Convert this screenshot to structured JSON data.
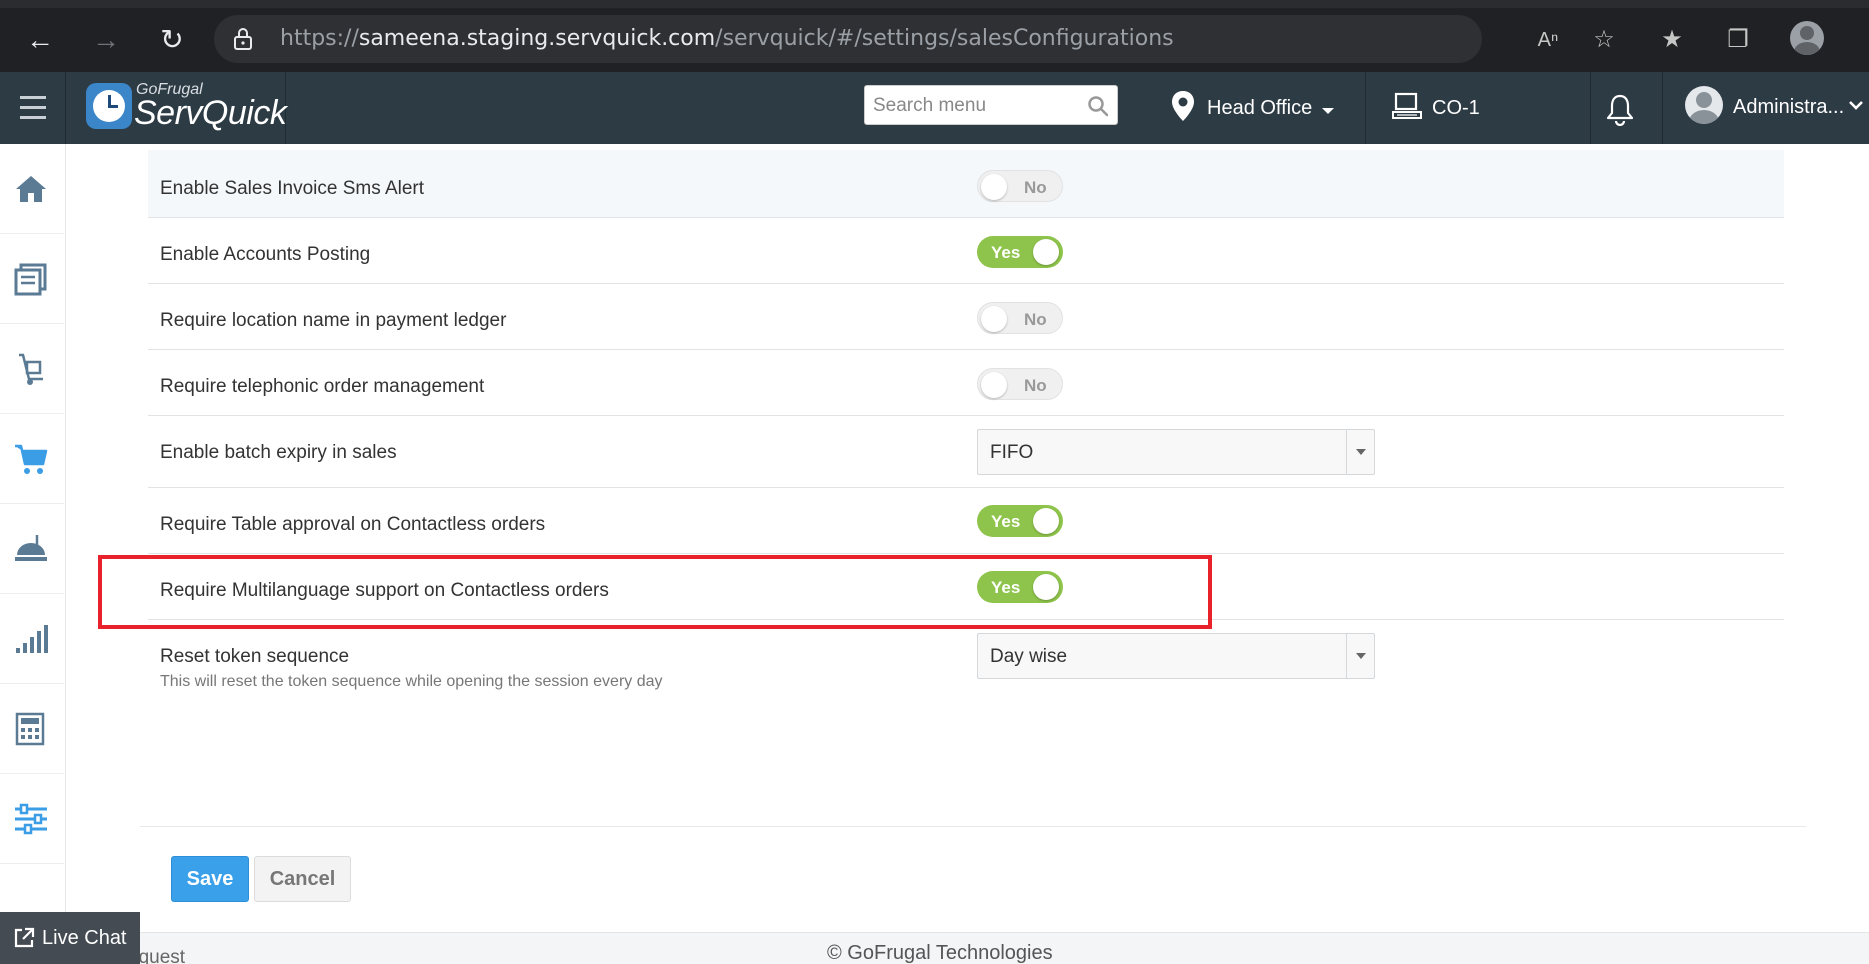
{
  "browser": {
    "url_prefix": "https://",
    "url_host": "sameena.staging.servquick.com",
    "url_path": "/servquick/#/settings/salesConfigurations"
  },
  "header": {
    "logo_small": "GoFrugal",
    "logo_big": "ServQuick",
    "search_placeholder": "Search menu",
    "location": "Head Office",
    "counter": "CO-1",
    "user": "Administra..."
  },
  "sidebar": {
    "items": [
      "home-icon",
      "books-icon",
      "trolley-icon",
      "cart-icon",
      "serve-dish-icon",
      "bar-chart-icon",
      "calculator-icon",
      "sliders-icon"
    ]
  },
  "settings": {
    "rows": [
      {
        "label": "Enable Sales Invoice Sms Alert",
        "control": "toggle",
        "value": "No"
      },
      {
        "label": "Enable Accounts Posting",
        "control": "toggle",
        "value": "Yes"
      },
      {
        "label": "Require location name in payment ledger",
        "control": "toggle",
        "value": "No"
      },
      {
        "label": "Require telephonic order management",
        "control": "toggle",
        "value": "No"
      },
      {
        "label": "Enable batch expiry in sales",
        "control": "select",
        "value": "FIFO"
      },
      {
        "label": "Require Table approval on Contactless orders",
        "control": "toggle",
        "value": "Yes"
      },
      {
        "label": "Require Multilanguage support on Contactless orders",
        "control": "toggle",
        "value": "Yes"
      },
      {
        "label": "Reset token sequence",
        "sublabel": "This will reset the token sequence while opening the session every day",
        "control": "select",
        "value": "Day wise"
      }
    ]
  },
  "actions": {
    "save": "Save",
    "cancel": "Cancel"
  },
  "footer": {
    "copyright": "© GoFrugal Technologies",
    "request": "equest",
    "live_chat": "Live Chat"
  },
  "colors": {
    "header_bg": "#2d3b45",
    "toggle_on": "#8ec44b",
    "save_button": "#3aa0ea",
    "highlight_box": "#e8212a"
  }
}
